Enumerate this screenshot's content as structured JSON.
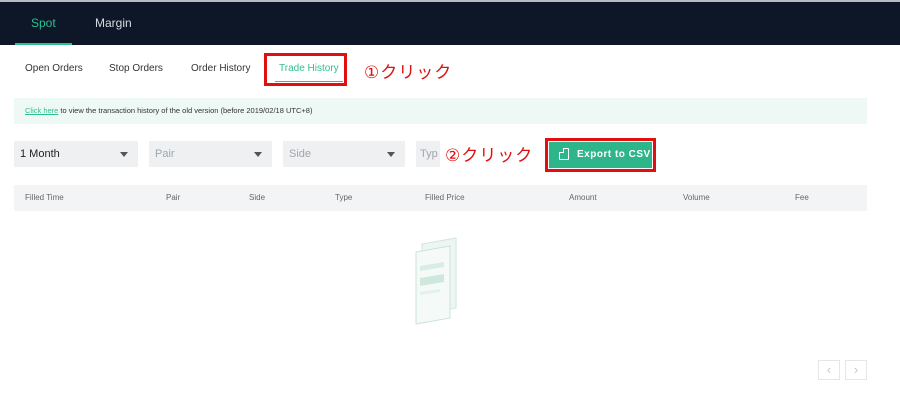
{
  "topbar": {
    "tabs": [
      {
        "label": "Spot",
        "active": true
      },
      {
        "label": "Margin",
        "active": false
      }
    ]
  },
  "subtabs": [
    {
      "label": "Open Orders",
      "active": false
    },
    {
      "label": "Stop Orders",
      "active": false
    },
    {
      "label": "Order History",
      "active": false
    },
    {
      "label": "Trade History",
      "active": true
    }
  ],
  "annotations": {
    "step1": "①クリック",
    "step2": "②クリック",
    "highlight_color": "#e01010"
  },
  "notice": {
    "link_text": "Click here",
    "text": " to view the transaction history of the old version (before 2019/02/18 UTC+8)"
  },
  "filters": {
    "period": {
      "value": "1 Month"
    },
    "pair": {
      "placeholder": "Pair"
    },
    "side": {
      "placeholder": "Side"
    },
    "type": {
      "placeholder": "Typ"
    }
  },
  "export_button": {
    "label": "Export to CSV",
    "icon": "doc-icon",
    "color": "#2fb58a"
  },
  "table": {
    "columns": [
      "Filled Time",
      "Pair",
      "Side",
      "Type",
      "Filled Price",
      "Amount",
      "Volume",
      "Fee"
    ],
    "rows": []
  },
  "pagination": {
    "prev": "‹",
    "next": "›"
  },
  "theme": {
    "accent": "#2fbf8f",
    "topbar_bg": "#0d1727"
  }
}
